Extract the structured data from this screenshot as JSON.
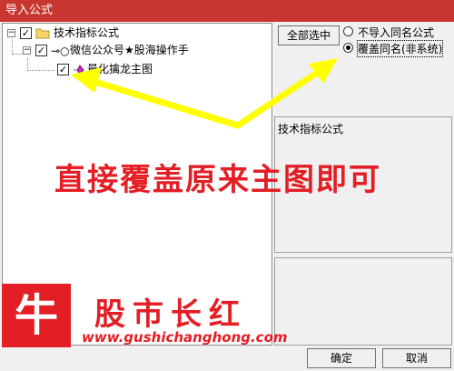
{
  "window": {
    "title": "导入公式"
  },
  "tree": {
    "root": {
      "label": "技术指标公式",
      "checked": true
    },
    "group": {
      "label": "微信公众号★股海操作手",
      "checked": true
    },
    "item": {
      "label": "量化擒龙主图",
      "checked": true
    }
  },
  "options": {
    "select_all_label": "全部选中",
    "radio_skip_label": "不导入同名公式",
    "radio_overwrite_label": "覆盖同名(非系统)",
    "selected": "overwrite"
  },
  "info": {
    "category": "技术指标公式"
  },
  "buttons": {
    "ok": "确定",
    "cancel": "取消"
  },
  "annotation": {
    "text": "直接覆盖原来主图即可",
    "color": "#e31e24"
  },
  "watermark": {
    "logo_char": "牛",
    "brand": "股市长红",
    "url": "www.gushichanghong.com"
  },
  "colors": {
    "titlebar": "#c8372f",
    "annotation": "#e31e24",
    "arrow": "#ffff00"
  }
}
